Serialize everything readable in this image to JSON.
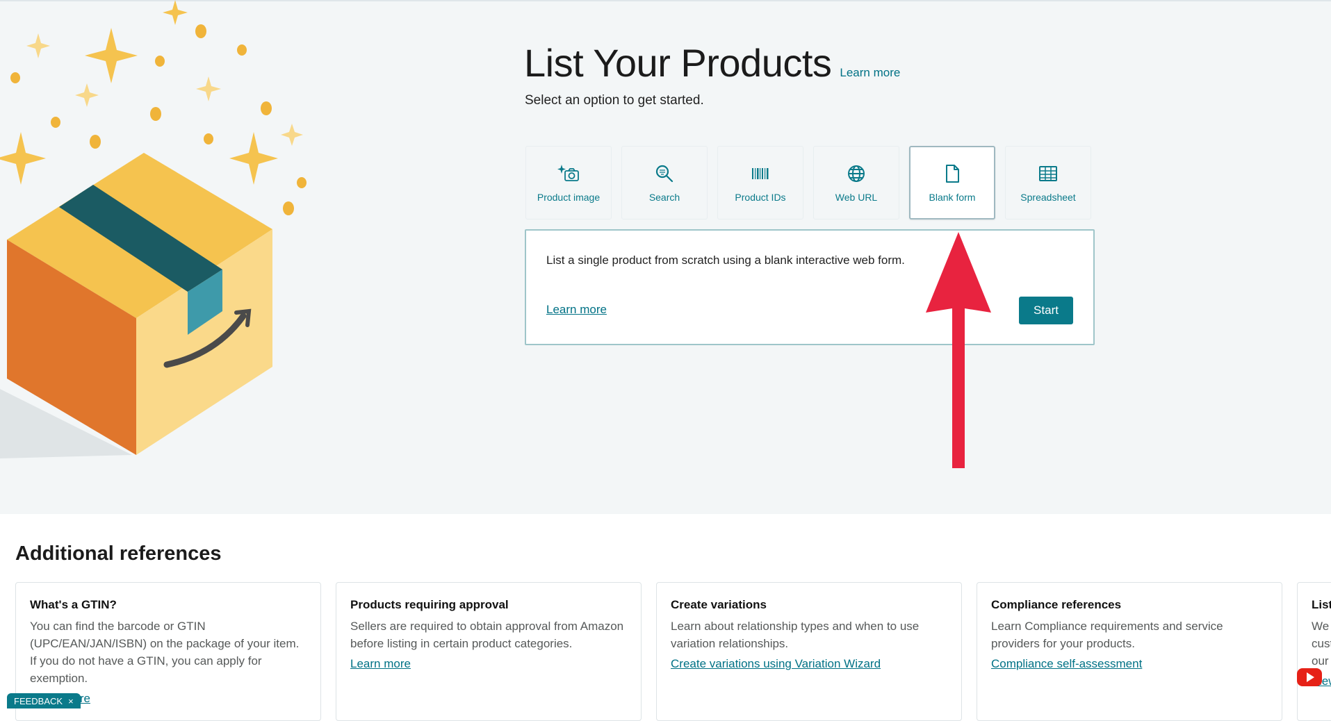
{
  "page": {
    "title": "List Your Products",
    "title_link": "Learn more",
    "subtitle": "Select an option to get started."
  },
  "options": [
    {
      "label": "Product image",
      "icon": "sparkle-camera-icon"
    },
    {
      "label": "Search",
      "icon": "magnify-icon"
    },
    {
      "label": "Product IDs",
      "icon": "barcode-icon"
    },
    {
      "label": "Web URL",
      "icon": "globe-icon"
    },
    {
      "label": "Blank form",
      "icon": "document-icon",
      "selected": true
    },
    {
      "label": "Spreadsheet",
      "icon": "spreadsheet-icon"
    }
  ],
  "detail": {
    "text": "List a single product from scratch using a blank interactive web form.",
    "learn_more": "Learn more",
    "start": "Start"
  },
  "references": {
    "title": "Additional references",
    "cards": [
      {
        "title": "What's a GTIN?",
        "body": "You can find the barcode or GTIN (UPC/EAN/JAN/ISBN) on the package of your item. If you do not have a GTIN, you can apply for exemption.",
        "link": "Learn more"
      },
      {
        "title": "Products requiring approval",
        "body": "Sellers are required to obtain approval from Amazon before listing in certain product categories.",
        "link": "Learn more"
      },
      {
        "title": "Create variations",
        "body": "Learn about relationship types and when to use variation relationships.",
        "link": "Create variations using Variation Wizard"
      },
      {
        "title": "Compliance references",
        "body": "Learn Compliance requirements and service providers for your products.",
        "link": "Compliance self-assessment"
      },
      {
        "title": "List",
        "body": "We cust our",
        "link": "View"
      }
    ]
  },
  "feedback": {
    "label": "FEEDBACK",
    "close": "×"
  },
  "colors": {
    "accent": "#0a7a8a",
    "link": "#007185",
    "arrow": "#e8233f",
    "box_orange": "#e0762c",
    "box_yellow": "#f5c34f",
    "tape": "#1b5b63"
  }
}
